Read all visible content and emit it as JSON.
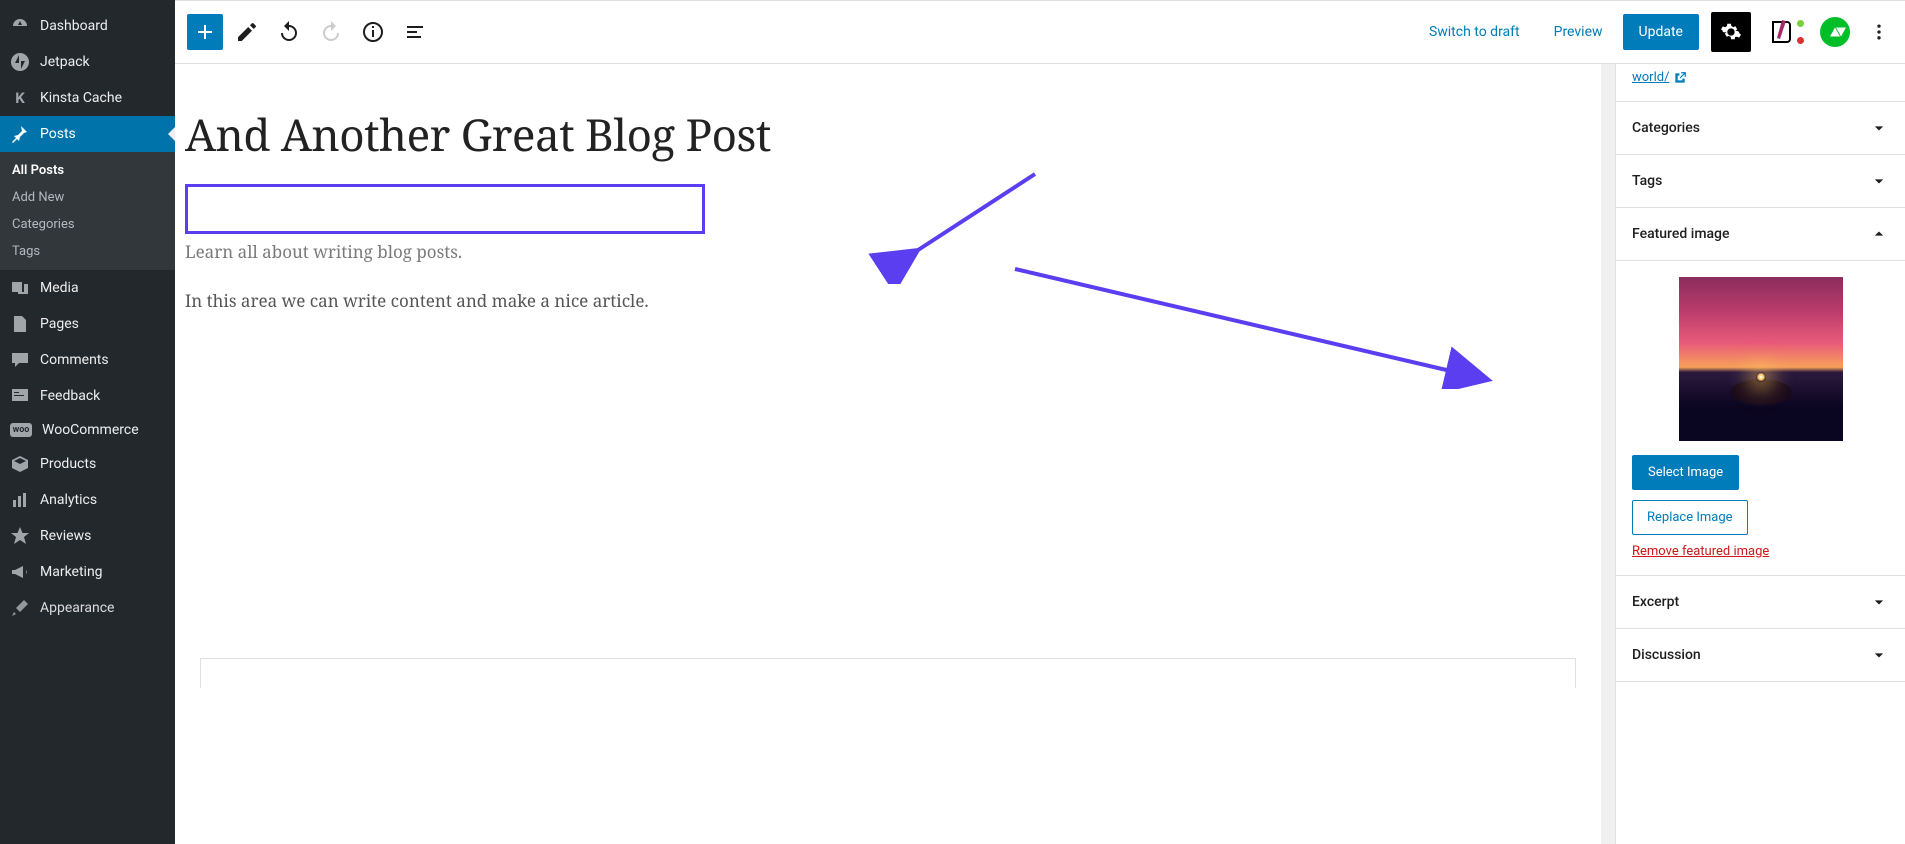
{
  "sidebar": {
    "items": [
      {
        "id": "dashboard",
        "label": "Dashboard",
        "icon": "gauge"
      },
      {
        "id": "jetpack",
        "label": "Jetpack",
        "icon": "jetpack"
      },
      {
        "id": "kinsta",
        "label": "Kinsta Cache",
        "icon": "K"
      },
      {
        "id": "posts",
        "label": "Posts",
        "icon": "pin",
        "active": true
      },
      {
        "id": "media",
        "label": "Media",
        "icon": "media"
      },
      {
        "id": "pages",
        "label": "Pages",
        "icon": "page"
      },
      {
        "id": "comments",
        "label": "Comments",
        "icon": "comment"
      },
      {
        "id": "feedback",
        "label": "Feedback",
        "icon": "feedback"
      },
      {
        "id": "woo",
        "label": "WooCommerce",
        "icon": "woo"
      },
      {
        "id": "products",
        "label": "Products",
        "icon": "box"
      },
      {
        "id": "analytics",
        "label": "Analytics",
        "icon": "bars"
      },
      {
        "id": "reviews",
        "label": "Reviews",
        "icon": "star"
      },
      {
        "id": "marketing",
        "label": "Marketing",
        "icon": "megaphone"
      },
      {
        "id": "appearance",
        "label": "Appearance",
        "icon": "brush"
      }
    ],
    "sub_posts": [
      {
        "label": "All Posts",
        "current": true
      },
      {
        "label": "Add New"
      },
      {
        "label": "Categories"
      },
      {
        "label": "Tags"
      }
    ]
  },
  "topbar": {
    "switch_draft": "Switch to draft",
    "preview": "Preview",
    "update": "Update"
  },
  "post": {
    "title": "And Another Great Blog Post",
    "para1": "Learn all about writing blog posts.",
    "para2": "In this area we can write content and make a nice article."
  },
  "right": {
    "permalink_frag": "world/",
    "categories": "Categories",
    "tags": "Tags",
    "featured": {
      "title": "Featured image",
      "select": "Select Image",
      "replace": "Replace Image",
      "remove": "Remove featured image"
    },
    "excerpt": "Excerpt",
    "discussion": "Discussion"
  },
  "annotations": {
    "arrow1_color": "#5a3ef0",
    "arrow2_color": "#5a3ef0"
  }
}
